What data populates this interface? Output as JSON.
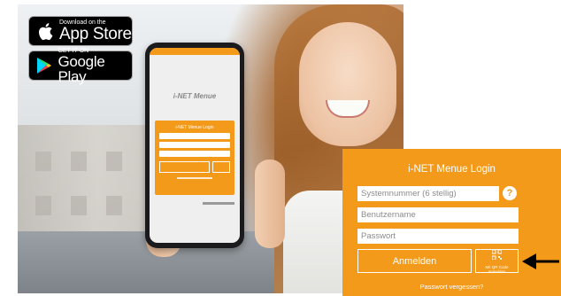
{
  "badges": {
    "app_store": {
      "small": "Download on the",
      "big": "App Store"
    },
    "google_play": {
      "small": "GET IT ON",
      "big": "Google Play"
    }
  },
  "phone_screen": {
    "logo_text": "i-NET Menue"
  },
  "login_panel": {
    "title": "i-NET Menue Login",
    "system_number_placeholder": "Systemnummer (6 stellig)",
    "username_placeholder": "Benutzername",
    "password_placeholder": "Passwort",
    "help_label": "?",
    "login_button": "Anmelden",
    "qr_button": "Mit QR Code anmelden",
    "forgot_password": "Passwort vergessen?"
  },
  "colors": {
    "accent": "#f39a1b",
    "badge_background": "#000000",
    "text_on_accent": "#ffffff"
  },
  "icons": [
    "apple-icon",
    "google-play-icon",
    "help-icon",
    "qr-code-icon",
    "arrow-left-icon"
  ]
}
